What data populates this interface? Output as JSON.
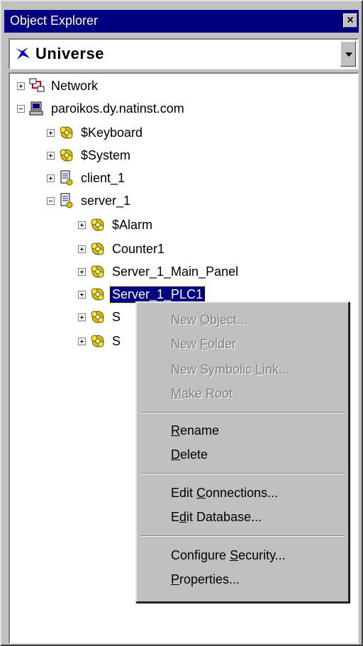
{
  "window": {
    "title": "Object Explorer"
  },
  "combo": {
    "value": "Universe"
  },
  "tree": {
    "nodes": [
      {
        "label": "Network"
      },
      {
        "label": "paroikos.dy.natinst.com"
      },
      {
        "label": "$Keyboard"
      },
      {
        "label": "$System"
      },
      {
        "label": "client_1"
      },
      {
        "label": "server_1"
      },
      {
        "label": "$Alarm"
      },
      {
        "label": "Counter1"
      },
      {
        "label": "Server_1_Main_Panel"
      },
      {
        "label": "Server_1_PLC1"
      },
      {
        "label": "S"
      },
      {
        "label": "S"
      }
    ]
  },
  "context_menu": {
    "items": [
      {
        "pre": "New ",
        "u": "O",
        "post": "bject...",
        "disabled": true
      },
      {
        "pre": "New ",
        "u": "F",
        "post": "older",
        "disabled": true
      },
      {
        "pre": "New Symbolic ",
        "u": "L",
        "post": "ink...",
        "disabled": true
      },
      {
        "pre": "",
        "u": "M",
        "post": "ake Root",
        "disabled": true
      },
      {
        "pre": "",
        "u": "R",
        "post": "ename",
        "disabled": false
      },
      {
        "pre": "",
        "u": "D",
        "post": "elete",
        "disabled": false
      },
      {
        "pre": "Edit ",
        "u": "C",
        "post": "onnections...",
        "disabled": false
      },
      {
        "pre": "E",
        "u": "d",
        "post": "it Database...",
        "disabled": false
      },
      {
        "pre": "Configure ",
        "u": "S",
        "post": "ecurity...",
        "disabled": false
      },
      {
        "pre": "",
        "u": "P",
        "post": "roperties...",
        "disabled": false
      }
    ]
  },
  "colors": {
    "titlebar": "#000080",
    "selection": "#000080",
    "face": "#c0c0c0"
  },
  "icons": {
    "universe": "universe-icon",
    "network": "network-icon",
    "computer": "computer-icon",
    "object": "object-icon",
    "server": "server-icon"
  }
}
